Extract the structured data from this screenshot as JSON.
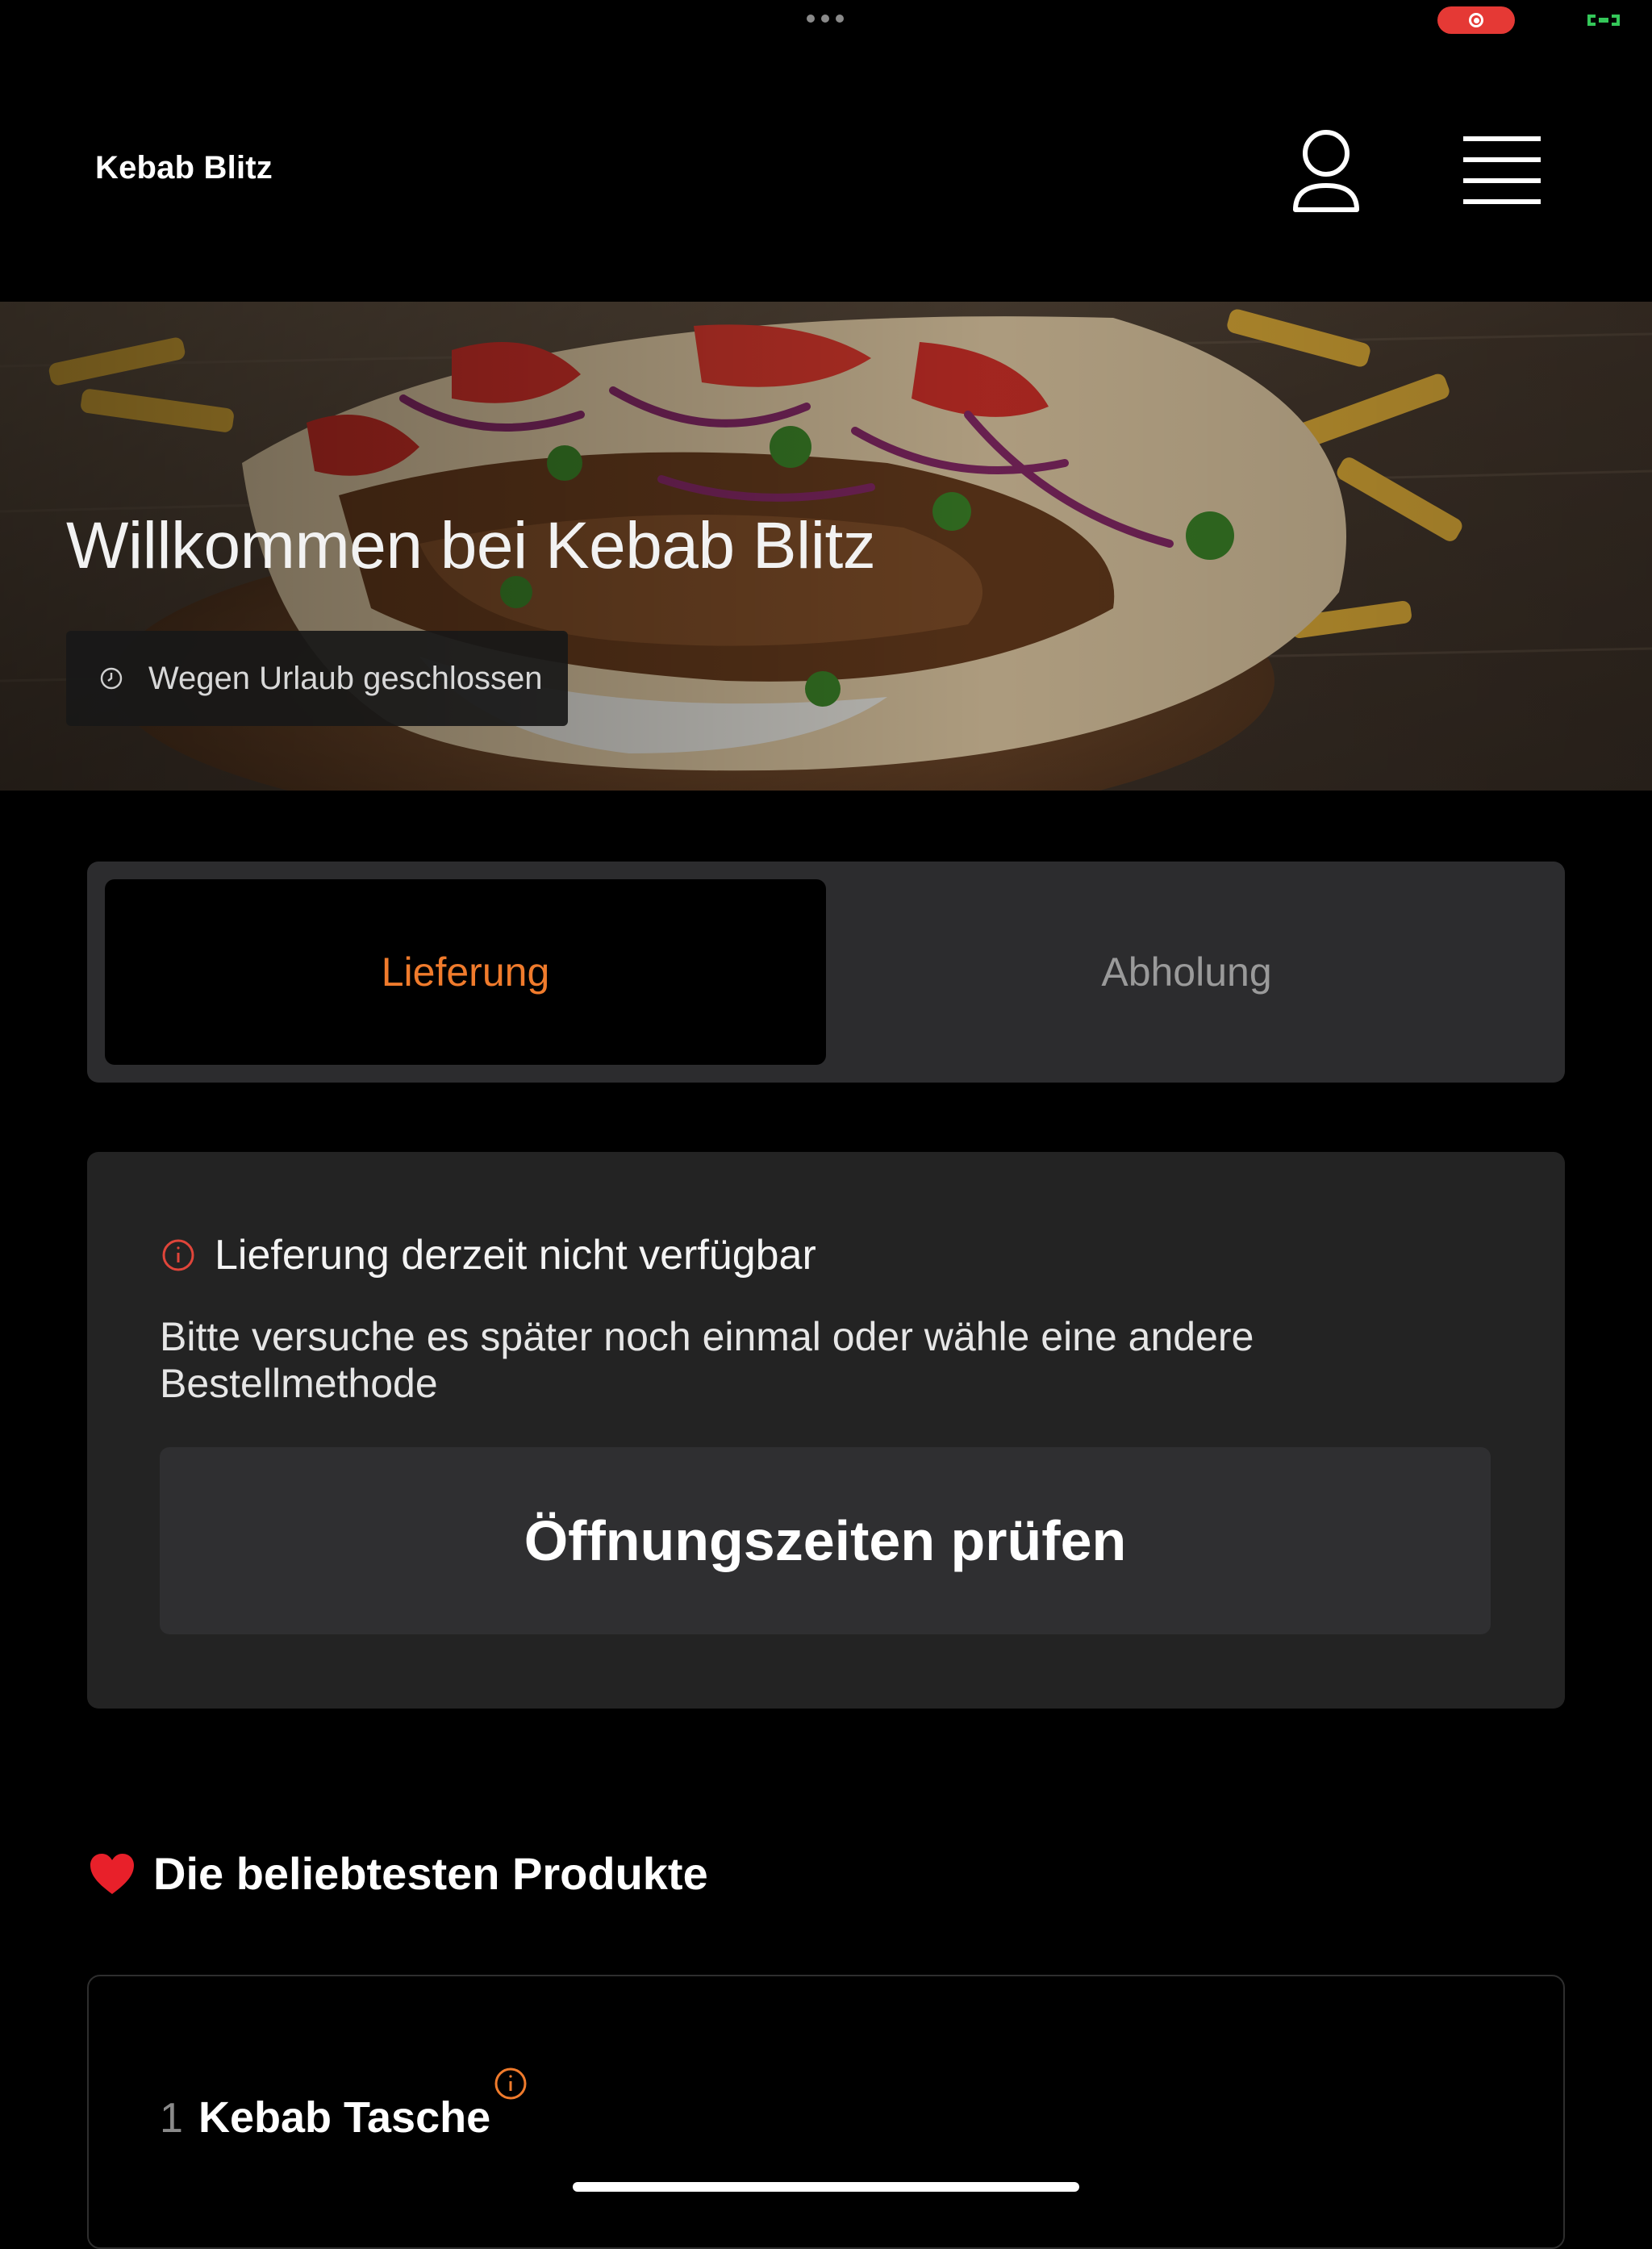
{
  "app": {
    "brand": "Kebab Blitz"
  },
  "hero": {
    "title": "Willkommen bei Kebab Blitz",
    "status_badge": "Wegen Urlaub geschlossen"
  },
  "order_modes": {
    "tabs": [
      {
        "label": "Lieferung",
        "active": true
      },
      {
        "label": "Abholung",
        "active": false
      }
    ]
  },
  "notice": {
    "title": "Lieferung derzeit nicht verfügbar",
    "body": "Bitte versuche es später noch einmal oder wähle eine andere Bestellmethode",
    "button": "Öffnungszeiten prüfen"
  },
  "popular": {
    "heading": "Die beliebtesten Produkte",
    "items": [
      {
        "rank": "1",
        "name": "Kebab Tasche"
      }
    ]
  },
  "colors": {
    "accent": "#f07b2c",
    "record": "#e53935",
    "battery": "#34c759"
  },
  "icons": [
    "more-dots-icon",
    "screen-record-icon",
    "battery-icon",
    "user-icon",
    "hamburger-menu-icon",
    "clock-icon",
    "info-icon",
    "heart-icon"
  ]
}
